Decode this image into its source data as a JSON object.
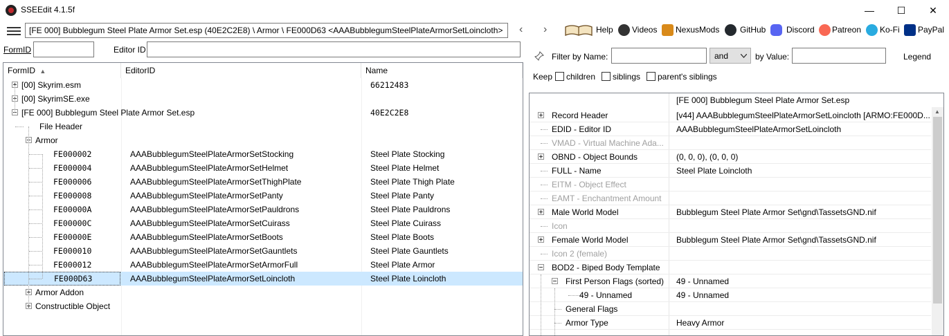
{
  "window": {
    "title": "SSEEdit 4.1.5f",
    "minimize": "—",
    "maximize": "☐",
    "close": "✕"
  },
  "toolbar": {
    "path": "[FE 000] Bubblegum Steel Plate Armor Set.esp (40E2C2E8) \\ Armor \\ FE000D63 <AAABubblegumSteelPlateArmorSetLoincloth>",
    "back": "‹",
    "forward": "›",
    "links": [
      {
        "label": "Help",
        "icon": "book-icon"
      },
      {
        "label": "Videos",
        "icon": "gamepad-icon"
      },
      {
        "label": "NexusMods",
        "icon": "nexus-icon"
      },
      {
        "label": "GitHub",
        "icon": "github-icon"
      },
      {
        "label": "Discord",
        "icon": "discord-icon"
      },
      {
        "label": "Patreon",
        "icon": "patreon-icon"
      },
      {
        "label": "Ko-Fi",
        "icon": "kofi-icon"
      },
      {
        "label": "PayPal",
        "icon": "paypal-icon"
      }
    ]
  },
  "left_filter": {
    "formid_label": "FormID",
    "formid_value": "",
    "editorid_label": "Editor ID",
    "editorid_value": ""
  },
  "left_grid": {
    "columns": [
      "FormID",
      "EditorID",
      "Name"
    ],
    "sort_indicator": "▲",
    "rows": [
      {
        "formid": "[00] Skyrim.esm",
        "editorid": "",
        "name": "66212483",
        "level": 0,
        "expander": "plus"
      },
      {
        "formid": "[00] SkyrimSE.exe",
        "editorid": "",
        "name": "",
        "level": 0,
        "expander": "plus"
      },
      {
        "formid": "[FE 000] Bubblegum Steel Plate Armor Set.esp",
        "editorid": "",
        "name": "40E2C2E8",
        "level": 0,
        "expander": "minus"
      },
      {
        "formid": "File Header",
        "editorid": "",
        "name": "",
        "level": 1,
        "expander": "none"
      },
      {
        "formid": "Armor",
        "editorid": "",
        "name": "",
        "level": 1,
        "expander": "minus"
      },
      {
        "formid": "FE000002",
        "editorid": "AAABubblegumSteelPlateArmorSetStocking",
        "name": "Steel Plate Stocking",
        "level": 2,
        "expander": "none"
      },
      {
        "formid": "FE000004",
        "editorid": "AAABubblegumSteelPlateArmorSetHelmet",
        "name": "Steel Plate Helmet",
        "level": 2,
        "expander": "none"
      },
      {
        "formid": "FE000006",
        "editorid": "AAABubblegumSteelPlateArmorSetThighPlate",
        "name": "Steel Plate Thigh Plate",
        "level": 2,
        "expander": "none"
      },
      {
        "formid": "FE000008",
        "editorid": "AAABubblegumSteelPlateArmorSetPanty",
        "name": "Steel Plate Panty",
        "level": 2,
        "expander": "none"
      },
      {
        "formid": "FE00000A",
        "editorid": "AAABubblegumSteelPlateArmorSetPauldrons",
        "name": "Steel Plate Pauldrons",
        "level": 2,
        "expander": "none"
      },
      {
        "formid": "FE00000C",
        "editorid": "AAABubblegumSteelPlateArmorSetCuirass",
        "name": "Steel Plate Cuirass",
        "level": 2,
        "expander": "none"
      },
      {
        "formid": "FE00000E",
        "editorid": "AAABubblegumSteelPlateArmorSetBoots",
        "name": "Steel Plate Boots",
        "level": 2,
        "expander": "none"
      },
      {
        "formid": "FE000010",
        "editorid": "AAABubblegumSteelPlateArmorSetGauntlets",
        "name": "Steel Plate Gauntlets",
        "level": 2,
        "expander": "none"
      },
      {
        "formid": "FE000012",
        "editorid": "AAABubblegumSteelPlateArmorSetArmorFull",
        "name": "Steel Plate Armor",
        "level": 2,
        "expander": "none"
      },
      {
        "formid": "FE000D63",
        "editorid": "AAABubblegumSteelPlateArmorSetLoincloth",
        "name": "Steel Plate Loincloth",
        "level": 2,
        "expander": "none",
        "selected": true
      },
      {
        "formid": "Armor Addon",
        "editorid": "",
        "name": "",
        "level": 1,
        "expander": "plus"
      },
      {
        "formid": "Constructible Object",
        "editorid": "",
        "name": "",
        "level": 1,
        "expander": "plus"
      }
    ]
  },
  "right_filter": {
    "filter_by_name_label": "Filter by Name:",
    "name_value": "",
    "operator": "and",
    "by_value_label": "by Value:",
    "value_value": "",
    "legend": "Legend",
    "keep_label": "Keep",
    "keep_options": [
      "children",
      "siblings",
      "parent's siblings"
    ]
  },
  "right_grid": {
    "header_value": "[FE 000] Bubblegum Steel Plate Armor Set.esp",
    "rows": [
      {
        "label": "Record Header",
        "value": "[v44] AAABubblegumSteelPlateArmorSetLoincloth [ARMO:FE000D...",
        "expander": "plus",
        "level": 0,
        "gray": false
      },
      {
        "label": "EDID - Editor ID",
        "value": "AAABubblegumSteelPlateArmorSetLoincloth",
        "expander": "none",
        "level": 0,
        "gray": false
      },
      {
        "label": "VMAD - Virtual Machine Ada...",
        "value": "",
        "expander": "none",
        "level": 0,
        "gray": true
      },
      {
        "label": "OBND - Object Bounds",
        "value": "(0, 0, 0), (0, 0, 0)",
        "expander": "plus",
        "level": 0,
        "gray": false
      },
      {
        "label": "FULL - Name",
        "value": "Steel Plate Loincloth",
        "expander": "none",
        "level": 0,
        "gray": false
      },
      {
        "label": "EITM - Object Effect",
        "value": "",
        "expander": "none",
        "level": 0,
        "gray": true
      },
      {
        "label": "EAMT - Enchantment Amount",
        "value": "",
        "expander": "none",
        "level": 0,
        "gray": true
      },
      {
        "label": "Male World Model",
        "value": "Bubblegum Steel Plate Armor Set\\gnd\\TassetsGND.nif",
        "expander": "plus",
        "level": 0,
        "gray": false
      },
      {
        "label": "Icon",
        "value": "",
        "expander": "none",
        "level": 0,
        "gray": true
      },
      {
        "label": "Female World Model",
        "value": "Bubblegum Steel Plate Armor Set\\gnd\\TassetsGND.nif",
        "expander": "plus",
        "level": 0,
        "gray": false
      },
      {
        "label": "Icon 2 (female)",
        "value": "",
        "expander": "none",
        "level": 0,
        "gray": true
      },
      {
        "label": "BOD2 - Biped Body Template",
        "value": "",
        "expander": "minus",
        "level": 0,
        "gray": false
      },
      {
        "label": "First Person Flags (sorted)",
        "value": "49 - Unnamed",
        "expander": "minus",
        "level": 1,
        "gray": false
      },
      {
        "label": "49 - Unnamed",
        "value": "49 - Unnamed",
        "expander": "none",
        "level": 2,
        "gray": false
      },
      {
        "label": "General Flags",
        "value": "",
        "expander": "none",
        "level": 1,
        "gray": false
      },
      {
        "label": "Armor Type",
        "value": "Heavy Armor",
        "expander": "none",
        "level": 1,
        "gray": false
      }
    ]
  }
}
